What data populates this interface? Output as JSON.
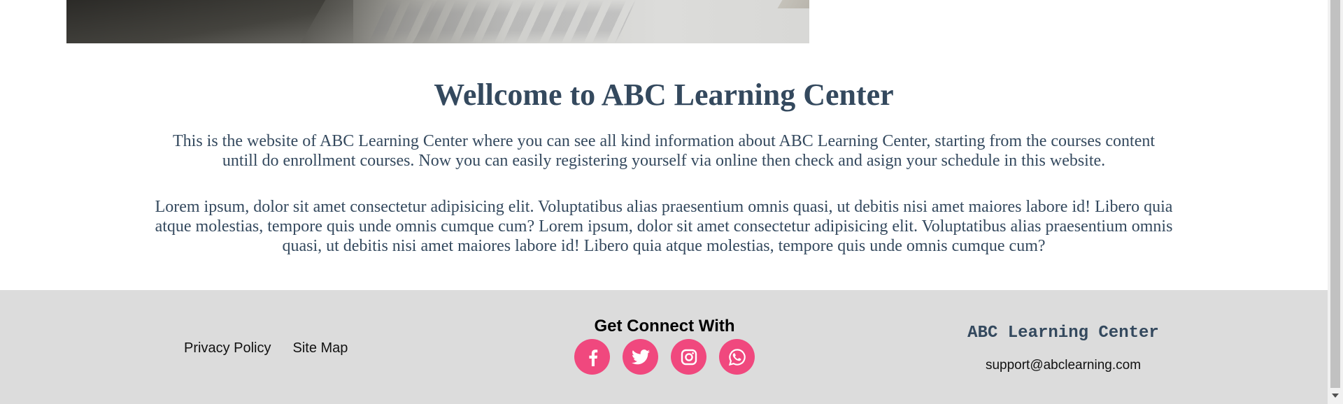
{
  "hero": {
    "image_alt": "laptop keyboard photo"
  },
  "main": {
    "title": "Wellcome to ABC Learning Center",
    "paragraph1": "This is the website of ABC Learning Center where you can see all kind information about ABC Learning Center, starting from the courses content untill do enrollment courses. Now you can easily registering yourself via online then check and asign your schedule in this website.",
    "paragraph2": "Lorem ipsum, dolor sit amet consectetur adipisicing elit. Voluptatibus alias praesentium omnis quasi, ut debitis nisi amet maiores labore id! Libero quia atque molestias, tempore quis unde omnis cumque cum? Lorem ipsum, dolor sit amet consectetur adipisicing elit. Voluptatibus alias praesentium omnis quasi, ut debitis nisi amet maiores labore id! Libero quia atque molestias, tempore quis unde omnis cumque cum?"
  },
  "footer": {
    "links": {
      "privacy": "Privacy Policy",
      "sitemap": "Site Map"
    },
    "connect_heading": "Get Connect With",
    "socials": [
      "facebook-icon",
      "twitter-icon",
      "instagram-icon",
      "whatsapp-icon"
    ],
    "brand": "ABC Learning Center",
    "email": "support@abclearning.com"
  },
  "colors": {
    "heading": "#34495e",
    "footer_bg": "#dcdcdc",
    "social_bg": "#f0487e"
  }
}
